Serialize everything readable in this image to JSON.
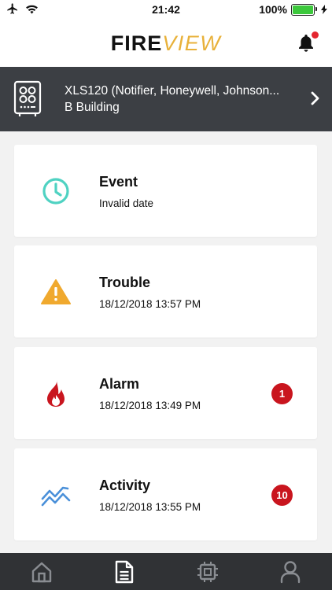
{
  "status_bar": {
    "time": "21:42",
    "battery_percent": "100%",
    "battery_level": 1.0,
    "icons": [
      "airplane-icon",
      "wifi-icon",
      "battery-icon",
      "charging-icon"
    ]
  },
  "header": {
    "logo_part1": "FIRE",
    "logo_part2": "VIEW",
    "notification_icon": "bell-icon",
    "has_notification_dot": true
  },
  "panel": {
    "name": "XLS120 (Notifier, Honeywell, Johnson...",
    "location": "B Building",
    "icon": "control-panel-icon",
    "chevron": "chevron-right-icon"
  },
  "cards": [
    {
      "key": "event",
      "title": "Event",
      "subtitle": "Invalid date",
      "icon": "clock-icon",
      "icon_color": "#4fd2c2",
      "badge": null
    },
    {
      "key": "trouble",
      "title": "Trouble",
      "subtitle": "18/12/2018 13:57 PM",
      "icon": "warning-icon",
      "icon_color": "#f0a92e",
      "badge": null
    },
    {
      "key": "alarm",
      "title": "Alarm",
      "subtitle": "18/12/2018 13:49 PM",
      "icon": "flame-icon",
      "icon_color": "#c9151e",
      "badge": "1"
    },
    {
      "key": "activity",
      "title": "Activity",
      "subtitle": "18/12/2018 13:55 PM",
      "icon": "activity-icon",
      "icon_color": "#4a90d9",
      "badge": "10"
    }
  ],
  "tab_bar": {
    "tabs": [
      {
        "key": "home",
        "icon": "home-icon",
        "active": false
      },
      {
        "key": "reports",
        "icon": "document-icon",
        "active": true
      },
      {
        "key": "devices",
        "icon": "chip-icon",
        "active": false
      },
      {
        "key": "profile",
        "icon": "user-icon",
        "active": false
      }
    ]
  },
  "colors": {
    "accent_yellow": "#e8b13a",
    "panel_bg": "#3c3f44",
    "tab_bar_bg": "#303235",
    "badge_red": "#c9151e",
    "background": "#f2f2f2"
  }
}
